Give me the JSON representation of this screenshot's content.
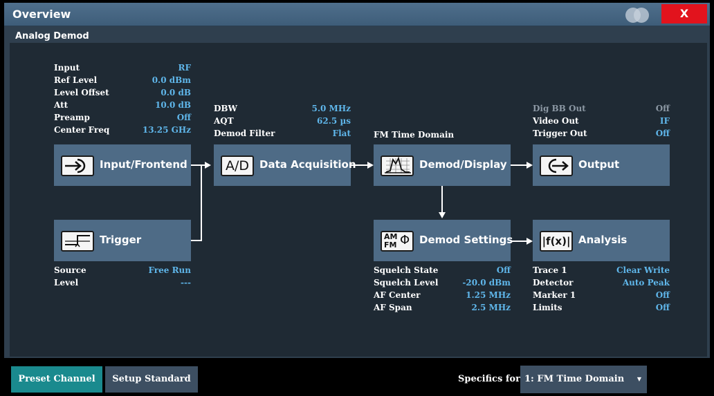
{
  "window": {
    "title": "Overview",
    "close_label": "X"
  },
  "section": {
    "label": "Analog Demod"
  },
  "input_params": [
    {
      "label": "Input",
      "value": "RF"
    },
    {
      "label": "Ref Level",
      "value": "0.0 dBm"
    },
    {
      "label": "Level Offset",
      "value": "0.0 dB"
    },
    {
      "label": "Att",
      "value": "10.0 dB"
    },
    {
      "label": "Preamp",
      "value": "Off"
    },
    {
      "label": "Center Freq",
      "value": "13.25 GHz"
    }
  ],
  "acq_params": [
    {
      "label": "DBW",
      "value": "5.0 MHz"
    },
    {
      "label": "AQT",
      "value": "62.5 µs"
    },
    {
      "label": "Demod Filter",
      "value": "Flat"
    }
  ],
  "demod_display_title": "FM Time Domain",
  "output_params": [
    {
      "label": "Dig BB Out",
      "value": "Off"
    },
    {
      "label": "Video Out",
      "value": "IF"
    },
    {
      "label": "Trigger Out",
      "value": "Off"
    }
  ],
  "trigger_params": [
    {
      "label": "Source",
      "value": "Free Run"
    },
    {
      "label": "Level",
      "value": "---"
    }
  ],
  "demod_params": [
    {
      "label": "Squelch State",
      "value": "Off"
    },
    {
      "label": "Squelch Level",
      "value": "-20.0 dBm"
    },
    {
      "label": "AF Center",
      "value": "1.25 MHz"
    },
    {
      "label": "AF Span",
      "value": "2.5 MHz"
    }
  ],
  "analysis_params": [
    {
      "label": "Trace 1",
      "value": "Clear Write"
    },
    {
      "label": "Detector",
      "value": "Auto Peak"
    },
    {
      "label": "Marker 1",
      "value": "Off"
    },
    {
      "label": "Limits",
      "value": "Off"
    }
  ],
  "blocks": {
    "input_frontend": "Input/Frontend",
    "data_acquisition": "Data Acquisition",
    "demod_display": "Demod/Display",
    "output": "Output",
    "trigger": "Trigger",
    "demod_settings": "Demod Settings",
    "analysis": "Analysis"
  },
  "icons": {
    "data_acquisition": "A/D",
    "analysis": "|f(x)|",
    "demod_am": "AM",
    "demod_fm": "FM",
    "demod_phi": "Φ"
  },
  "footer": {
    "preset_channel": "Preset Channel",
    "setup_standard": "Setup Standard",
    "specifics_label": "Specifics for",
    "specifics_value": "1: FM Time Domain"
  },
  "colors": {
    "accent_teal": "#1a8a8e",
    "value_blue": "#5fb6ea",
    "block_bg": "#4e6b86",
    "close_red": "#e2131d"
  }
}
